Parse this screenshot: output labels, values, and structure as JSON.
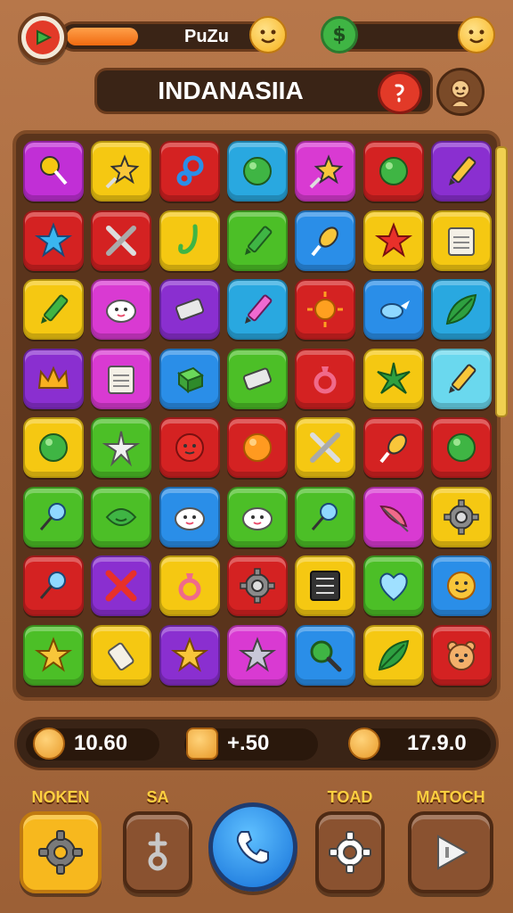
{
  "topbar": {
    "progress_label": "PuZu",
    "progress_fraction": 0.34
  },
  "level": {
    "name": "INDANASIIA"
  },
  "board": {
    "rows": [
      [
        {
          "color": "#c12fd6",
          "icon": "lollipop-icon"
        },
        {
          "color": "#f5c812",
          "icon": "star-wand-icon"
        },
        {
          "color": "#d42222",
          "icon": "link-icon"
        },
        {
          "color": "#29a8e0",
          "icon": "green-ball-icon"
        },
        {
          "color": "#d93ad2",
          "icon": "star-wand-icon"
        },
        {
          "color": "#d42222",
          "icon": "green-ball-icon"
        },
        {
          "color": "#8a2fd0",
          "icon": "pencil-icon"
        }
      ],
      [
        {
          "color": "#d42222",
          "icon": "blue-star-icon"
        },
        {
          "color": "#d42222",
          "icon": "crossed-tools-icon"
        },
        {
          "color": "#f5c812",
          "icon": "hook-icon"
        },
        {
          "color": "#4cbf27",
          "icon": "crayon-icon"
        },
        {
          "color": "#2a8ee8",
          "icon": "rocket-icon"
        },
        {
          "color": "#f5c812",
          "icon": "red-star-icon"
        },
        {
          "color": "#f5c812",
          "icon": "notepad-icon"
        }
      ],
      [
        {
          "color": "#f5c812",
          "icon": "crayon-icon"
        },
        {
          "color": "#d93ad2",
          "icon": "cloud-face-icon"
        },
        {
          "color": "#8a2fd0",
          "icon": "eraser-icon"
        },
        {
          "color": "#29a8e0",
          "icon": "pink-pencil-icon"
        },
        {
          "color": "#d42222",
          "icon": "sun-icon"
        },
        {
          "color": "#2a8ee8",
          "icon": "bird-icon"
        },
        {
          "color": "#29a8e0",
          "icon": "leaf-icon"
        }
      ],
      [
        {
          "color": "#8a2fd0",
          "icon": "crown-icon"
        },
        {
          "color": "#d93ad2",
          "icon": "notepad-icon"
        },
        {
          "color": "#2a8ee8",
          "icon": "cube-icon"
        },
        {
          "color": "#4cbf27",
          "icon": "eraser-icon"
        },
        {
          "color": "#d42222",
          "icon": "ring-icon"
        },
        {
          "color": "#f5c812",
          "icon": "starfish-icon"
        },
        {
          "color": "#6ad8ee",
          "icon": "pencil-icon"
        }
      ],
      [
        {
          "color": "#f5c812",
          "icon": "green-ball-icon"
        },
        {
          "color": "#4cbf27",
          "icon": "white-star-icon"
        },
        {
          "color": "#d42222",
          "icon": "red-face-icon"
        },
        {
          "color": "#d42222",
          "icon": "orange-ball-icon"
        },
        {
          "color": "#f5c812",
          "icon": "crossed-tools-icon"
        },
        {
          "color": "#d42222",
          "icon": "rocket-icon"
        },
        {
          "color": "#d42222",
          "icon": "green-ball-icon"
        }
      ],
      [
        {
          "color": "#4cbf27",
          "icon": "drop-pin-icon"
        },
        {
          "color": "#4cbf27",
          "icon": "green-face-icon"
        },
        {
          "color": "#2a8ee8",
          "icon": "cloud-face-icon"
        },
        {
          "color": "#4cbf27",
          "icon": "cloud-face-icon"
        },
        {
          "color": "#4cbf27",
          "icon": "drop-pin-icon"
        },
        {
          "color": "#d93ad2",
          "icon": "feather-icon"
        },
        {
          "color": "#f5c812",
          "icon": "gear-icon"
        }
      ],
      [
        {
          "color": "#d42222",
          "icon": "drop-pin-icon"
        },
        {
          "color": "#8a2fd0",
          "icon": "x-mark-icon"
        },
        {
          "color": "#f5c812",
          "icon": "ring-icon"
        },
        {
          "color": "#d42222",
          "icon": "gear-icon"
        },
        {
          "color": "#f5c812",
          "icon": "list-icon"
        },
        {
          "color": "#4cbf27",
          "icon": "heart-icon"
        },
        {
          "color": "#2a8ee8",
          "icon": "smile-face-icon"
        }
      ],
      [
        {
          "color": "#4cbf27",
          "icon": "gold-star-icon"
        },
        {
          "color": "#f5c812",
          "icon": "bottle-icon"
        },
        {
          "color": "#8a2fd0",
          "icon": "gold-star-icon"
        },
        {
          "color": "#d93ad2",
          "icon": "silver-star-icon"
        },
        {
          "color": "#2a8ee8",
          "icon": "magnifier-icon"
        },
        {
          "color": "#f5c812",
          "icon": "leaf-icon"
        },
        {
          "color": "#d42222",
          "icon": "bear-face-icon"
        }
      ]
    ]
  },
  "stats": [
    {
      "icon": "coin-face-icon",
      "value": "10.60"
    },
    {
      "icon": "chat-face-icon",
      "value": "+.50"
    },
    {
      "icon": "smile-face-icon",
      "value": "17.9.0"
    }
  ],
  "controls": {
    "noken_label": "NOKEN",
    "sa_label": "SA",
    "toad_label": "TOAD",
    "matoch_label": "MATOCH"
  }
}
